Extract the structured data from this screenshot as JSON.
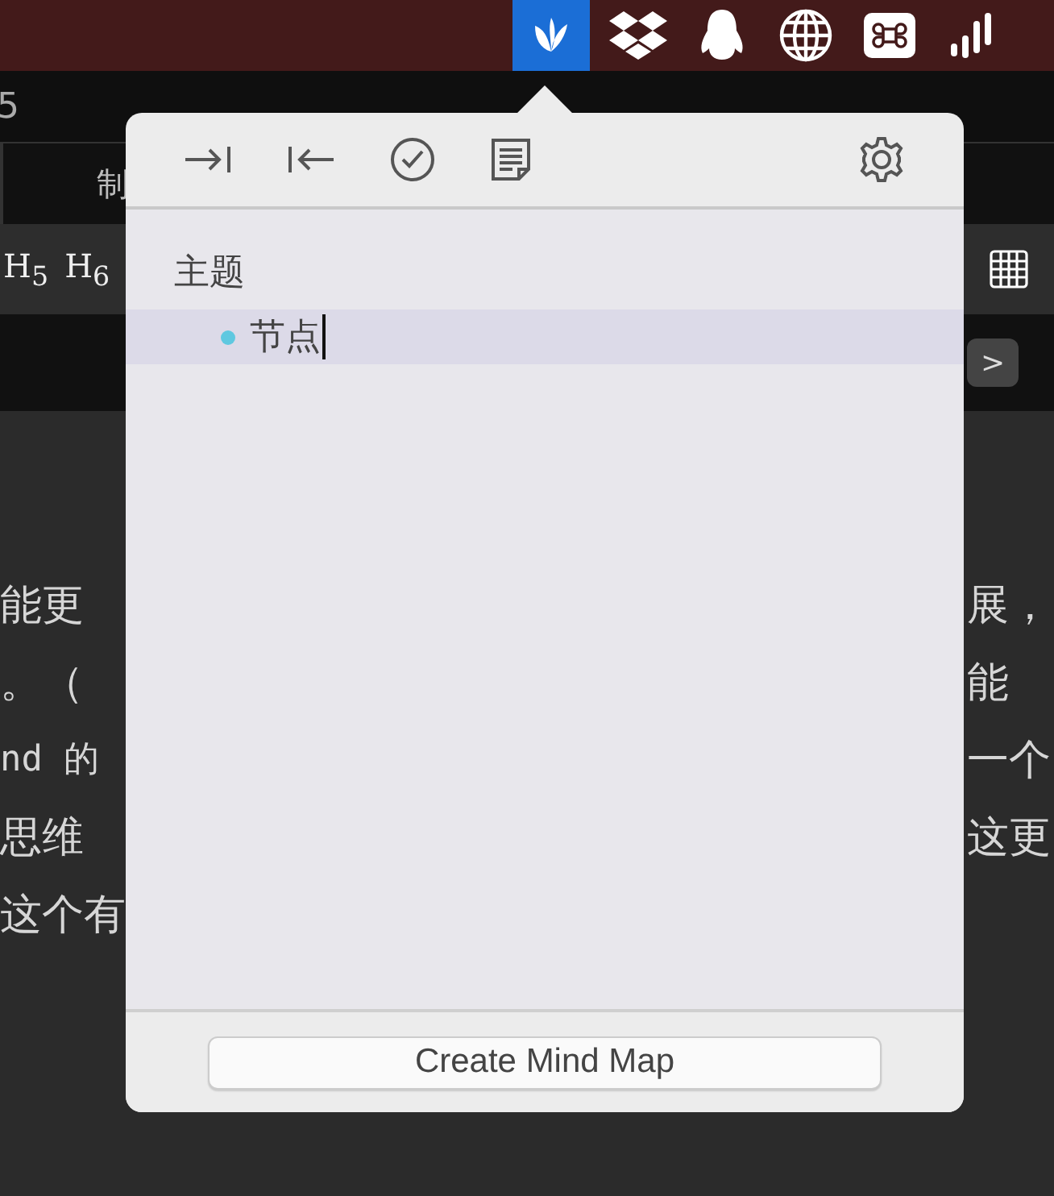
{
  "menu_bar": {
    "status_icons": [
      {
        "kind": "leaf",
        "selected": true
      },
      {
        "kind": "dropbox",
        "selected": false
      },
      {
        "kind": "penguin",
        "selected": false
      },
      {
        "kind": "globe",
        "selected": false
      },
      {
        "kind": "command",
        "selected": false
      },
      {
        "kind": "bars",
        "selected": false
      }
    ]
  },
  "background_app": {
    "number": "5",
    "tab": "制",
    "headings": [
      "H$_{5}$",
      "H$_{6}$"
    ],
    "next_button": ">",
    "editor_lines": [
      {
        "left": "能更",
        "right": "展，"
      },
      {
        "left": "。（",
        "right": "能"
      },
      {
        "left": "nd 的",
        "right": "一个"
      },
      {
        "left": "思维",
        "right": "这更"
      },
      {
        "left": "这个有"
      }
    ]
  },
  "popover": {
    "outline": {
      "title": "主题",
      "children": [
        {
          "text": "节点",
          "selected": true
        }
      ]
    },
    "button": "Create Mind Map"
  }
}
